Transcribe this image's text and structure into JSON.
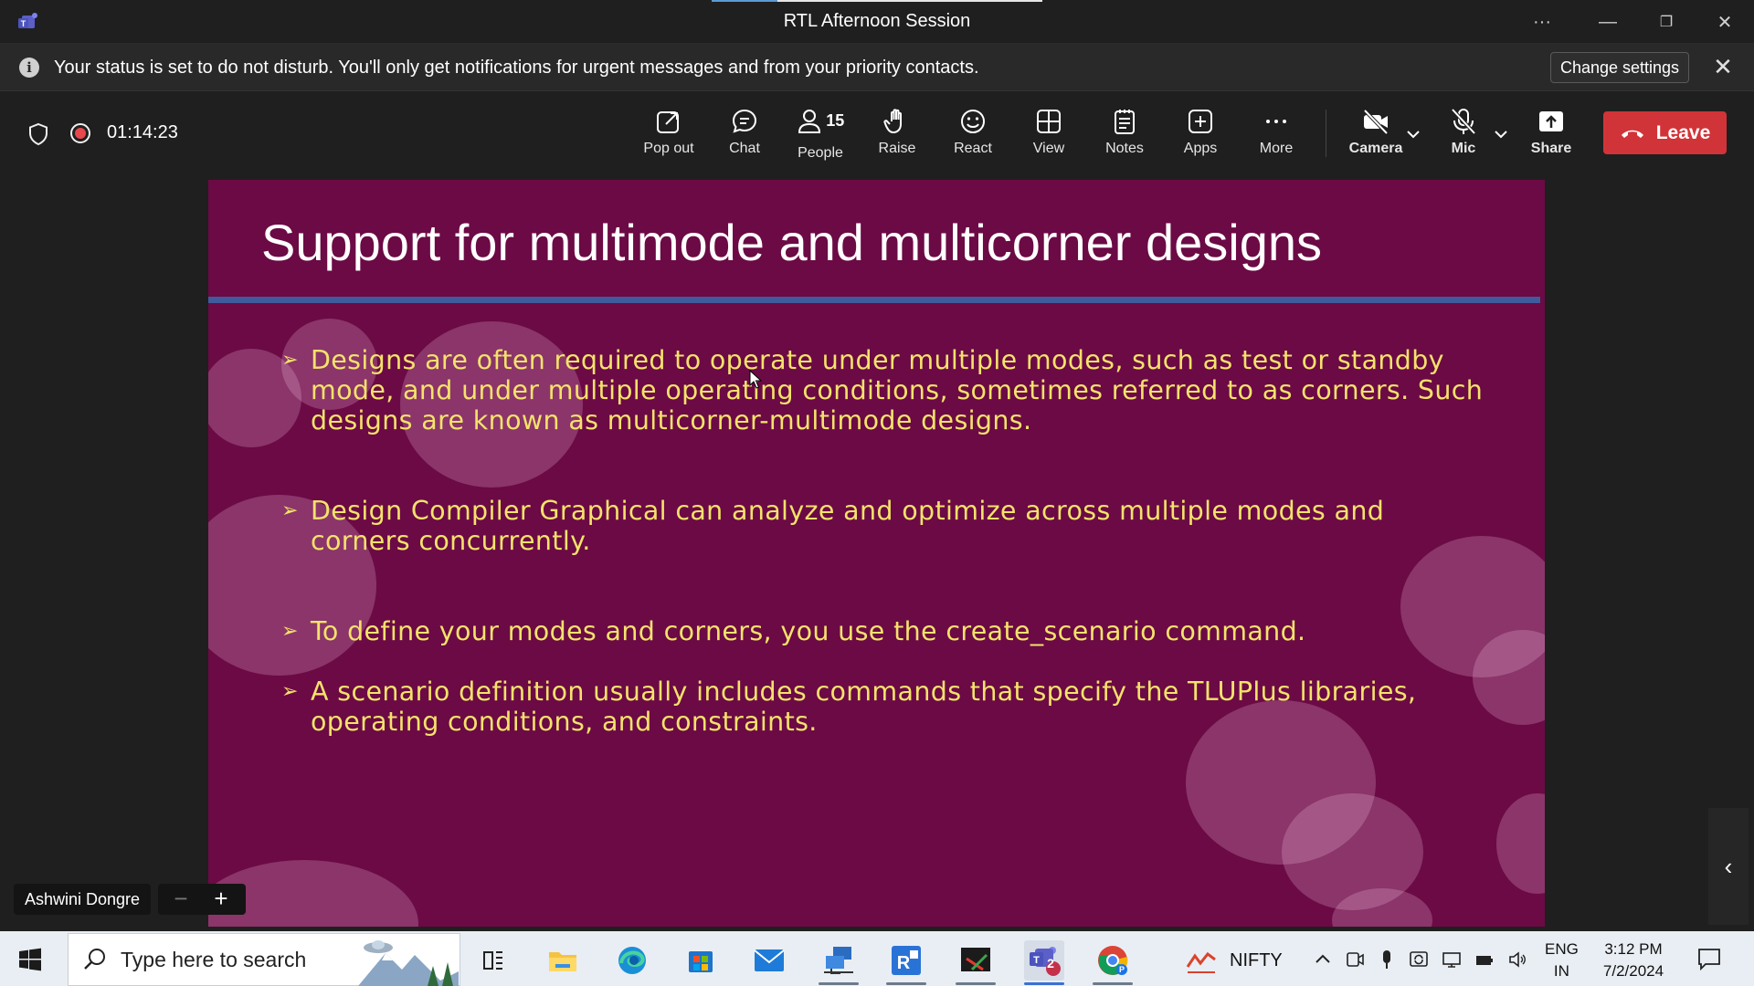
{
  "window": {
    "title": "RTL Afternoon Session"
  },
  "notification": {
    "text": "Your status is set to do not disturb. You'll only get notifications for urgent messages and from your priority contacts.",
    "change_settings_label": "Change settings"
  },
  "meeting": {
    "timer": "01:14:23",
    "people_count": "15",
    "toolbar": {
      "pop_out": "Pop out",
      "chat": "Chat",
      "people": "People",
      "raise": "Raise",
      "react": "React",
      "view": "View",
      "notes": "Notes",
      "apps": "Apps",
      "more": "More",
      "camera": "Camera",
      "mic": "Mic",
      "share": "Share",
      "leave": "Leave"
    },
    "leave_color": "#d13438"
  },
  "slide": {
    "title": "Support for multimode and multicorner designs",
    "bullets": [
      "Designs are often required to operate under multiple modes, such as test or standby mode, and under multiple operating conditions, sometimes referred to as corners. Such designs are known as multicorner-multimode designs.",
      "Design Compiler Graphical can analyze and optimize across multiple modes and corners concurrently.",
      "To define your modes and corners, you use the create_scenario command.",
      "A scenario definition usually includes commands that specify the TLUPlus libraries, operating conditions, and constraints."
    ],
    "background_color": "#6b0a45",
    "bullet_color": "#f4e26b"
  },
  "presenter": {
    "name": "Ashwini Dongre"
  },
  "taskbar": {
    "search_placeholder": "Type here to search",
    "nifty_label": "NIFTY",
    "teams_badge": "2",
    "lang_top": "ENG",
    "lang_bottom": "IN",
    "time": "3:12 PM",
    "date": "7/2/2024"
  }
}
